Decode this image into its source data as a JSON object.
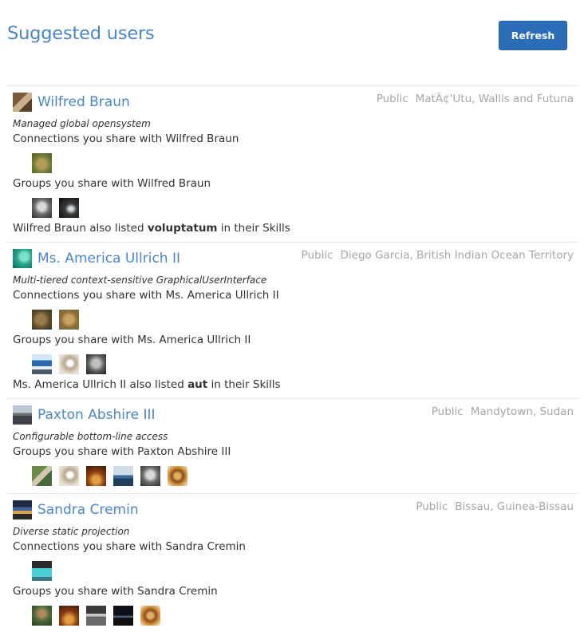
{
  "page": {
    "title": "Suggested users",
    "refresh_label": "Refresh"
  },
  "users": [
    {
      "name": "Wilfred Braun",
      "avatar_icon": "door-photo",
      "visibility": "Public",
      "location": "MatÃ¢'Utu, Wallis and Futuna",
      "tagline": "Managed global opensystem",
      "connections_label": "Connections you share with Wilfred Braun",
      "connections": [
        "moss-photo"
      ],
      "groups_label": "Groups you share with Wilfred Braun",
      "groups": [
        "face-photo",
        "tunnel-photo"
      ],
      "skills_prefix": "Wilfred Braun also listed ",
      "skill": "voluptatum",
      "skills_suffix": " in their Skills"
    },
    {
      "name": "Ms. America Ullrich II",
      "avatar_icon": "sea-photo",
      "visibility": "Public",
      "location": "Diego Garcia, British Indian Ocean Territory",
      "tagline": "Multi-tiered context-sensitive GraphicalUserInterface",
      "connections_label": "Connections you share with Ms. America Ullrich II",
      "connections": [
        "lion-photo",
        "owl-photo"
      ],
      "groups_label": "Groups you share with Ms. America Ullrich II",
      "groups": [
        "bus-photo",
        "pipe-photo",
        "face-photo"
      ],
      "skills_prefix": "Ms. America Ullrich II also listed ",
      "skill": "aut",
      "skills_suffix": " in their Skills"
    },
    {
      "name": "Paxton Abshire III",
      "avatar_icon": "gate-photo",
      "visibility": "Public",
      "location": "Mandytown, Sudan",
      "tagline": "Configurable bottom-line access",
      "groups_label": "Groups you share with Paxton Abshire III",
      "groups": [
        "field-photo",
        "pipe-photo",
        "autumn-photo",
        "ship-photo",
        "face-photo",
        "burger-photo"
      ]
    },
    {
      "name": "Sandra Cremin",
      "avatar_icon": "dusk-photo",
      "visibility": "Public",
      "location": "Bissau, Guinea-Bissau",
      "tagline": "Diverse static projection",
      "connections_label": "Connections you share with Sandra Cremin",
      "connections": [
        "swim-photo"
      ],
      "groups_label": "Groups you share with Sandra Cremin",
      "groups": [
        "tree-photo",
        "autumn-photo",
        "bw-photo",
        "night-photo",
        "burger-photo"
      ]
    }
  ]
}
